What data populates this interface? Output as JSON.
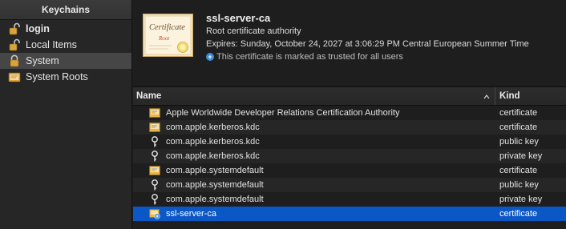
{
  "sidebar": {
    "title": "Keychains",
    "items": [
      {
        "label": "login",
        "icon": "lock-open-icon",
        "bold": true
      },
      {
        "label": "Local Items",
        "icon": "lock-open-icon",
        "bold": false
      },
      {
        "label": "System",
        "icon": "lock-closed-icon",
        "bold": false,
        "selected": true
      },
      {
        "label": "System Roots",
        "icon": "folder-icon",
        "bold": false
      }
    ]
  },
  "detail": {
    "name": "ssl-server-ca",
    "type": "Root certificate authority",
    "expires": "Expires: Sunday, October 24, 2027 at 3:06:29 PM Central European Summer Time",
    "trust_message": "This certificate is marked as trusted for all users",
    "cert_image_line1": "Certificate",
    "cert_image_line2": "Root"
  },
  "table": {
    "columns": {
      "name": "Name",
      "kind": "Kind"
    },
    "rows": [
      {
        "name": "Apple Worldwide Developer Relations Certification Authority",
        "kind": "certificate",
        "icon": "certificate-icon"
      },
      {
        "name": "com.apple.kerberos.kdc",
        "kind": "certificate",
        "icon": "certificate-icon"
      },
      {
        "name": "com.apple.kerberos.kdc",
        "kind": "public key",
        "icon": "key-icon"
      },
      {
        "name": "com.apple.kerberos.kdc",
        "kind": "private key",
        "icon": "key-icon"
      },
      {
        "name": "com.apple.systemdefault",
        "kind": "certificate",
        "icon": "certificate-icon"
      },
      {
        "name": "com.apple.systemdefault",
        "kind": "public key",
        "icon": "key-icon"
      },
      {
        "name": "com.apple.systemdefault",
        "kind": "private key",
        "icon": "key-icon"
      },
      {
        "name": "ssl-server-ca",
        "kind": "certificate",
        "icon": "trusted-certificate-icon",
        "selected": true
      }
    ]
  },
  "colors": {
    "selection_blue": "#0b57c6",
    "trust_blue": "#3a8bd6",
    "lock_gold": "#d9a43a"
  }
}
